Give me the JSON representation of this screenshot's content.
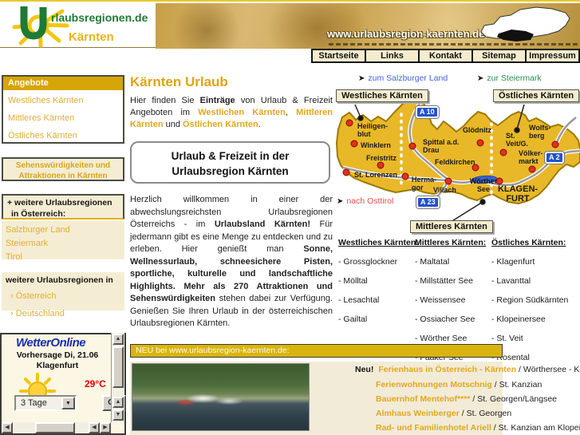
{
  "header": {
    "logo_line1": "rlaubsregionen.de",
    "logo_line2": "Kärnten",
    "domain": "www.urlaubsregion-kaernten.de"
  },
  "nav": {
    "items": [
      "Startseite",
      "Links",
      "Kontakt",
      "Sitemap",
      "Impressum"
    ]
  },
  "sidebar": {
    "angebote": {
      "title": "Angebote",
      "links": [
        "Westliches Kärnten",
        "Mittleres Kärnten",
        "Östliches Kärnten"
      ]
    },
    "attractions_line1": "Sehenswürdigkeiten und",
    "attractions_line2": "Attraktionen in Kärnten",
    "more_austria": {
      "title_line1": "+ weitere Urlaubsregionen",
      "title_line2": "in Österreich:",
      "links": [
        "Salzburger Land",
        "Steiermark",
        "Tirol"
      ]
    },
    "more_regions": {
      "title": "weitere Urlaubsregionen in",
      "links": [
        "› Österreich",
        "› Deutschland"
      ]
    },
    "weather": {
      "brand": "WetterOnline",
      "forecast": "Vorhersage Di, 21.06",
      "city": "Klagenfurt",
      "temperature": "29°C",
      "range": "3 Tage",
      "go": "GO"
    }
  },
  "main": {
    "title": "Kärnten Urlaub",
    "intro": [
      {
        "text": "Hier finden Sie "
      },
      {
        "text": "Einträge"
      },
      {
        "text": " von Urlaub & Freizeit Angeboten im "
      },
      {
        "text": "Westlichen Kärnten"
      },
      {
        "text": ", "
      },
      {
        "text": "Mittleren Kärnten"
      },
      {
        "text": " und "
      },
      {
        "text": "Östlichen Kärnten"
      },
      {
        "text": "."
      }
    ],
    "box_line1": "Urlaub & Freizeit in der",
    "box_line2": "Urlaubsregion Kärnten",
    "body": [
      {
        "text": "Herzlich willkommen in einer der abwechslungsreichsten Urlaubsregionen Österreichs - im "
      },
      {
        "text": "Urlaubsland Kärnten!"
      },
      {
        "text": " Für jedermann gibt es eine Menge zu entdecken und zu erleben. Hier genießt man "
      },
      {
        "text": "Sonne, Wellnessurlaub, schneesichere Pisten, sportliche, kulturelle und landschaftliche Highlights. Mehr als 270 Attraktionen und Sehenswürdigkeiten"
      },
      {
        "text": " stehen dabei zur Verfügung. Genießen Sie Ihren Urlaub in der österreichischen Urlaubsregionen Kärnten."
      }
    ]
  },
  "map": {
    "arrow": "➤",
    "link_salzburg": "zum Salzburger Land",
    "link_steiermark": "zur Steiermark",
    "link_osttirol": "nach Osttirol",
    "label_west": "Westliches Kärnten",
    "label_mittel": "Mittleres Kärnten",
    "label_ost": "Östliches Kärnten",
    "badge_a10": "A 10",
    "badge_a2": "A 2",
    "badge_a23": "A 23",
    "land_color": "#e9b829",
    "towns": [
      "Heiligen- blut",
      "Winklern",
      "Freistritz",
      "St. Lorenzen",
      "Herma- gor",
      "Villach",
      "Spittal a.d. Drau",
      "Glödnitz",
      "Feldkirchen",
      "St. Veit/G.",
      "Wolfs- berg",
      "Völker- markt",
      "Wörther See",
      "KLAGEN- FURT"
    ]
  },
  "region_links": {
    "columns": [
      {
        "title": "Westliches Kärnten:",
        "items": [
          "- Grossglockner",
          "- Mölltal",
          "- Lesachtal",
          "- Gailtal"
        ]
      },
      {
        "title": "Mittleres Kärnten:",
        "items": [
          "- Maltatal",
          "- Millstätter See",
          "- Weissensee",
          "- Ossiacher See",
          "- Wörther See",
          "- Faaker See"
        ]
      },
      {
        "title": "Östliches Kärnten:",
        "items": [
          "- Klagenfurt",
          "- Lavanttal",
          "- Region Südkärnten",
          "- Klopeinersee",
          "- St. Veit",
          "- Rosental"
        ]
      }
    ]
  },
  "news": {
    "bar_title": "NEU bei www.urlaubsregion-kaernten.de:",
    "flag": "Neu!",
    "separator": "/",
    "items": [
      {
        "link": "Ferienhaus in Österreich - Kärnten",
        "location": "Wörthersee - Klagenfurt"
      },
      {
        "link": "Ferienwohnungen Motschnig",
        "location": "St. Kanzian"
      },
      {
        "link": "Bauernhof Mentehof****",
        "location": "St. Georgen/Längsee"
      },
      {
        "link": "Almhaus Weinberger",
        "location": "St. Georgen"
      },
      {
        "link": "Rad- und Familienhotel Ariell",
        "location": "St. Kanzian am Klopeiner See"
      }
    ]
  }
}
